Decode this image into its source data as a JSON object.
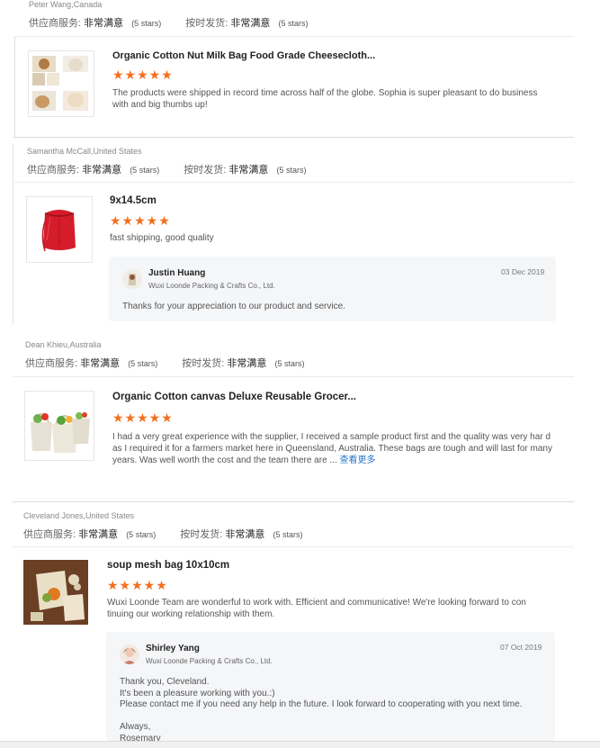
{
  "labels": {
    "supplier_service": "供应商服务:",
    "shipment": "按时发货:",
    "very_satisfied": "非常满意",
    "five_stars": "(5 stars)",
    "stars_glyph": "★★★★★",
    "read_more": "查看更多"
  },
  "reviews": [
    {
      "reviewer": "Peter Wang,Canada",
      "product_title": "Organic Cotton Nut Milk Bag Food Grade Cheesecloth...",
      "rating": 5,
      "text": "The products were shipped in record time across half of the globe. Sophia is super pleasant to do business with and big thumbs up!"
    },
    {
      "reviewer": "Samantha McCall,United States",
      "product_title": "9x14.5cm",
      "rating": 5,
      "text": "fast shipping, good quality",
      "reply": {
        "name": "Justin Huang",
        "company": "Wuxi Loonde Packing & Crafts Co., Ltd.",
        "date": "03 Dec 2019",
        "body": "Thanks for your appreciation to our product and service."
      }
    },
    {
      "reviewer": "Dean Khieu,Australia",
      "product_title": "Organic Cotton canvas Deluxe Reusable Grocer...",
      "rating": 5,
      "text": "I had a very great experience with the supplier, I received a sample product first and the quality was very har d as I required it for a farmers market here in Queensland, Australia. These bags are tough and will last for many years. Was well worth the cost and the team there are ..."
    },
    {
      "reviewer": "Cleveland Jones,United States",
      "product_title": "soup mesh bag 10x10cm",
      "rating": 5,
      "text": "Wuxi Loonde Team are wonderful to work with.  Efficient and communicative!  We're looking forward to con tinuing our working relationship with them.",
      "reply": {
        "name": "Shirley Yang",
        "company": "Wuxi Loonde Packing & Crafts Co., Ltd.",
        "date": "07 Oct 2019",
        "body": "Thank you, Cleveland.\nIt's been a pleasure working with you.:)\nPlease contact me if you need any help in the future. I look forward to cooperating with you next time.\n\nAlways,\nRosemary"
      }
    }
  ]
}
